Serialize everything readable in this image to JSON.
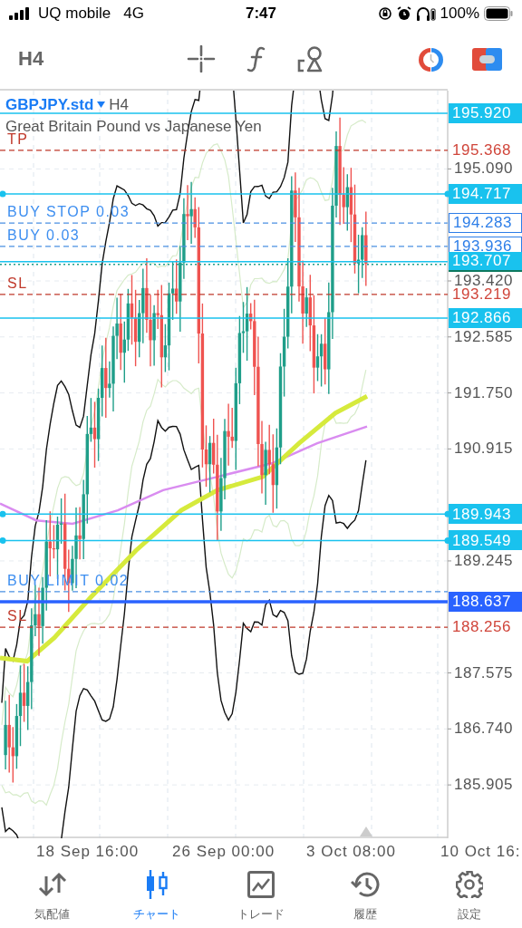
{
  "status_bar": {
    "carrier": "UQ mobile",
    "network": "4G",
    "time": "7:47",
    "battery": "100%"
  },
  "toolbar": {
    "timeframe": "H4"
  },
  "chart": {
    "symbol": "GBPJPY.std",
    "timeframe": "H4",
    "description": "Great Britain Pound vs Japanese Yen",
    "price_ticks": [
      "195.090",
      "193.420",
      "192.585",
      "191.750",
      "190.915",
      "189.245",
      "187.575",
      "186.740",
      "185.905"
    ],
    "levels": [
      {
        "kind": "alert",
        "price": "195.920",
        "handles": false
      },
      {
        "kind": "tp",
        "label": "TP",
        "price": "195.368"
      },
      {
        "kind": "alert",
        "price": "194.717",
        "handles": true
      },
      {
        "kind": "pending",
        "label": "BUY STOP 0.03",
        "price": "194.283"
      },
      {
        "kind": "pending",
        "label": "BUY 0.03",
        "price": "193.936"
      },
      {
        "kind": "current",
        "price": "193.707"
      },
      {
        "kind": "sl",
        "label": "SL",
        "price": "193.219"
      },
      {
        "kind": "alert",
        "price": "192.866",
        "handles": false
      },
      {
        "kind": "alert",
        "price": "189.943",
        "handles": true
      },
      {
        "kind": "alert",
        "price": "189.549",
        "handles": true
      },
      {
        "kind": "pending",
        "label": "BUY LIMIT 0.02"
      },
      {
        "kind": "position",
        "price": "188.637"
      },
      {
        "kind": "sl",
        "label": "SL",
        "price": "188.256"
      }
    ],
    "time_labels": [
      "18 Sep 16:00",
      "26 Sep 00:00",
      "3 Oct 08:00",
      "10 Oct 16:"
    ]
  },
  "tabs": [
    {
      "kind": "quotes",
      "label": "気配値",
      "selected": false
    },
    {
      "kind": "chart",
      "label": "チャート",
      "selected": true
    },
    {
      "kind": "trade",
      "label": "トレード",
      "selected": false
    },
    {
      "kind": "history",
      "label": "履歴",
      "selected": false
    },
    {
      "kind": "settings",
      "label": "設定",
      "selected": false
    }
  ]
}
